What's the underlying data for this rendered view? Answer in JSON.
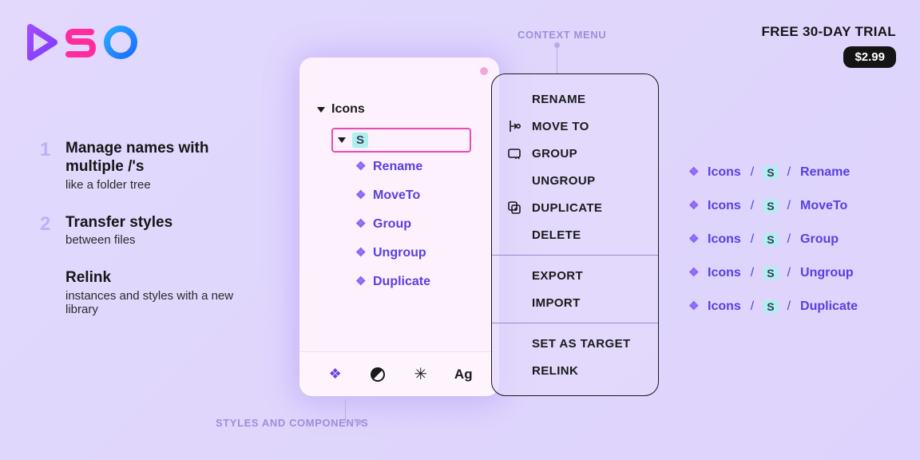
{
  "header": {
    "trial_text": "FREE 30-DAY TRIAL",
    "price": "$2.99"
  },
  "labels": {
    "context_menu": "CONTEXT MENU",
    "styles_components": "STYLES AND COMPONENTS"
  },
  "features": [
    {
      "num": "1",
      "title": "Manage names with multiple /'s",
      "sub": "like a folder tree"
    },
    {
      "num": "2",
      "title": "Transfer styles",
      "sub": "between files"
    },
    {
      "num": "",
      "title": "Relink",
      "sub": "instances and styles with a new library"
    }
  ],
  "tree": {
    "root": "Icons",
    "selected": "S",
    "leaves": [
      "Rename",
      "MoveTo",
      "Group",
      "Ungroup",
      "Duplicate"
    ]
  },
  "footer_icons": {
    "ag": "Ag"
  },
  "context_menu": {
    "group1": [
      {
        "icon": "",
        "label": "RENAME"
      },
      {
        "icon": "moveto",
        "label": "MOVE TO"
      },
      {
        "icon": "group",
        "label": "GROUP"
      },
      {
        "icon": "",
        "label": "UNGROUP"
      },
      {
        "icon": "duplicate",
        "label": "DUPLICATE"
      },
      {
        "icon": "",
        "label": "DELETE"
      }
    ],
    "group2": [
      {
        "icon": "",
        "label": "EXPORT"
      },
      {
        "icon": "",
        "label": "IMPORT"
      }
    ],
    "group3": [
      {
        "icon": "",
        "label": "SET AS TARGET"
      },
      {
        "icon": "",
        "label": "RELINK"
      }
    ]
  },
  "paths": {
    "prefix": "Icons",
    "mid": "S",
    "items": [
      "Rename",
      "MoveTo",
      "Group",
      "Ungroup",
      "Duplicate"
    ]
  }
}
